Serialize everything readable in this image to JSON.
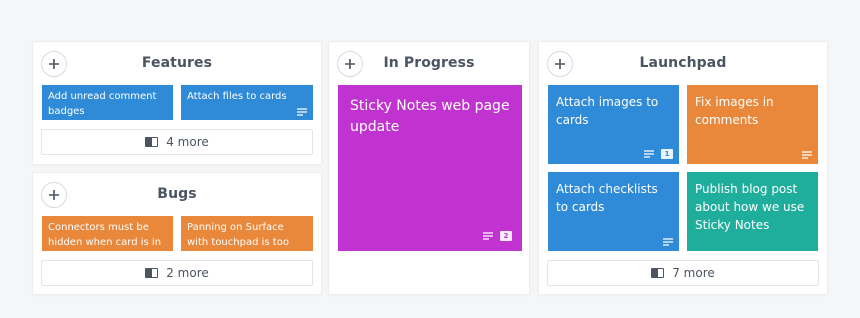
{
  "columns": {
    "features": {
      "title": "Features",
      "more_label": "4 more",
      "cards": [
        {
          "text": "Add unread comment badges",
          "color": "#2f8ad8"
        },
        {
          "text": "Attach files to cards",
          "color": "#2f8ad8"
        }
      ]
    },
    "bugs": {
      "title": "Bugs",
      "more_label": "2 more",
      "cards": [
        {
          "text": "Connectors must be hidden when card is in ...",
          "color": "#e9873b"
        },
        {
          "text": "Panning on Surface with touchpad is too slow",
          "color": "#e9873b"
        }
      ]
    },
    "in_progress": {
      "title": "In Progress",
      "cards": [
        {
          "text": "Sticky Notes web page update",
          "color": "#c033d0",
          "comment_count": "2"
        }
      ]
    },
    "launchpad": {
      "title": "Launchpad",
      "more_label": "7 more",
      "cards": [
        {
          "text": "Attach images to cards",
          "color": "#2f8ad8",
          "comment_count": "1"
        },
        {
          "text": "Fix images in comments",
          "color": "#e9873b"
        },
        {
          "text": "Attach checklists to cards",
          "color": "#2f8ad8"
        },
        {
          "text": "Publish blog post about how we use Sticky Notes",
          "color": "#1fae9c"
        }
      ]
    }
  },
  "icons": {
    "add": "plus-icon",
    "notes": "notes-lines-icon",
    "comment": "comment-icon",
    "more": "panel-icon"
  }
}
